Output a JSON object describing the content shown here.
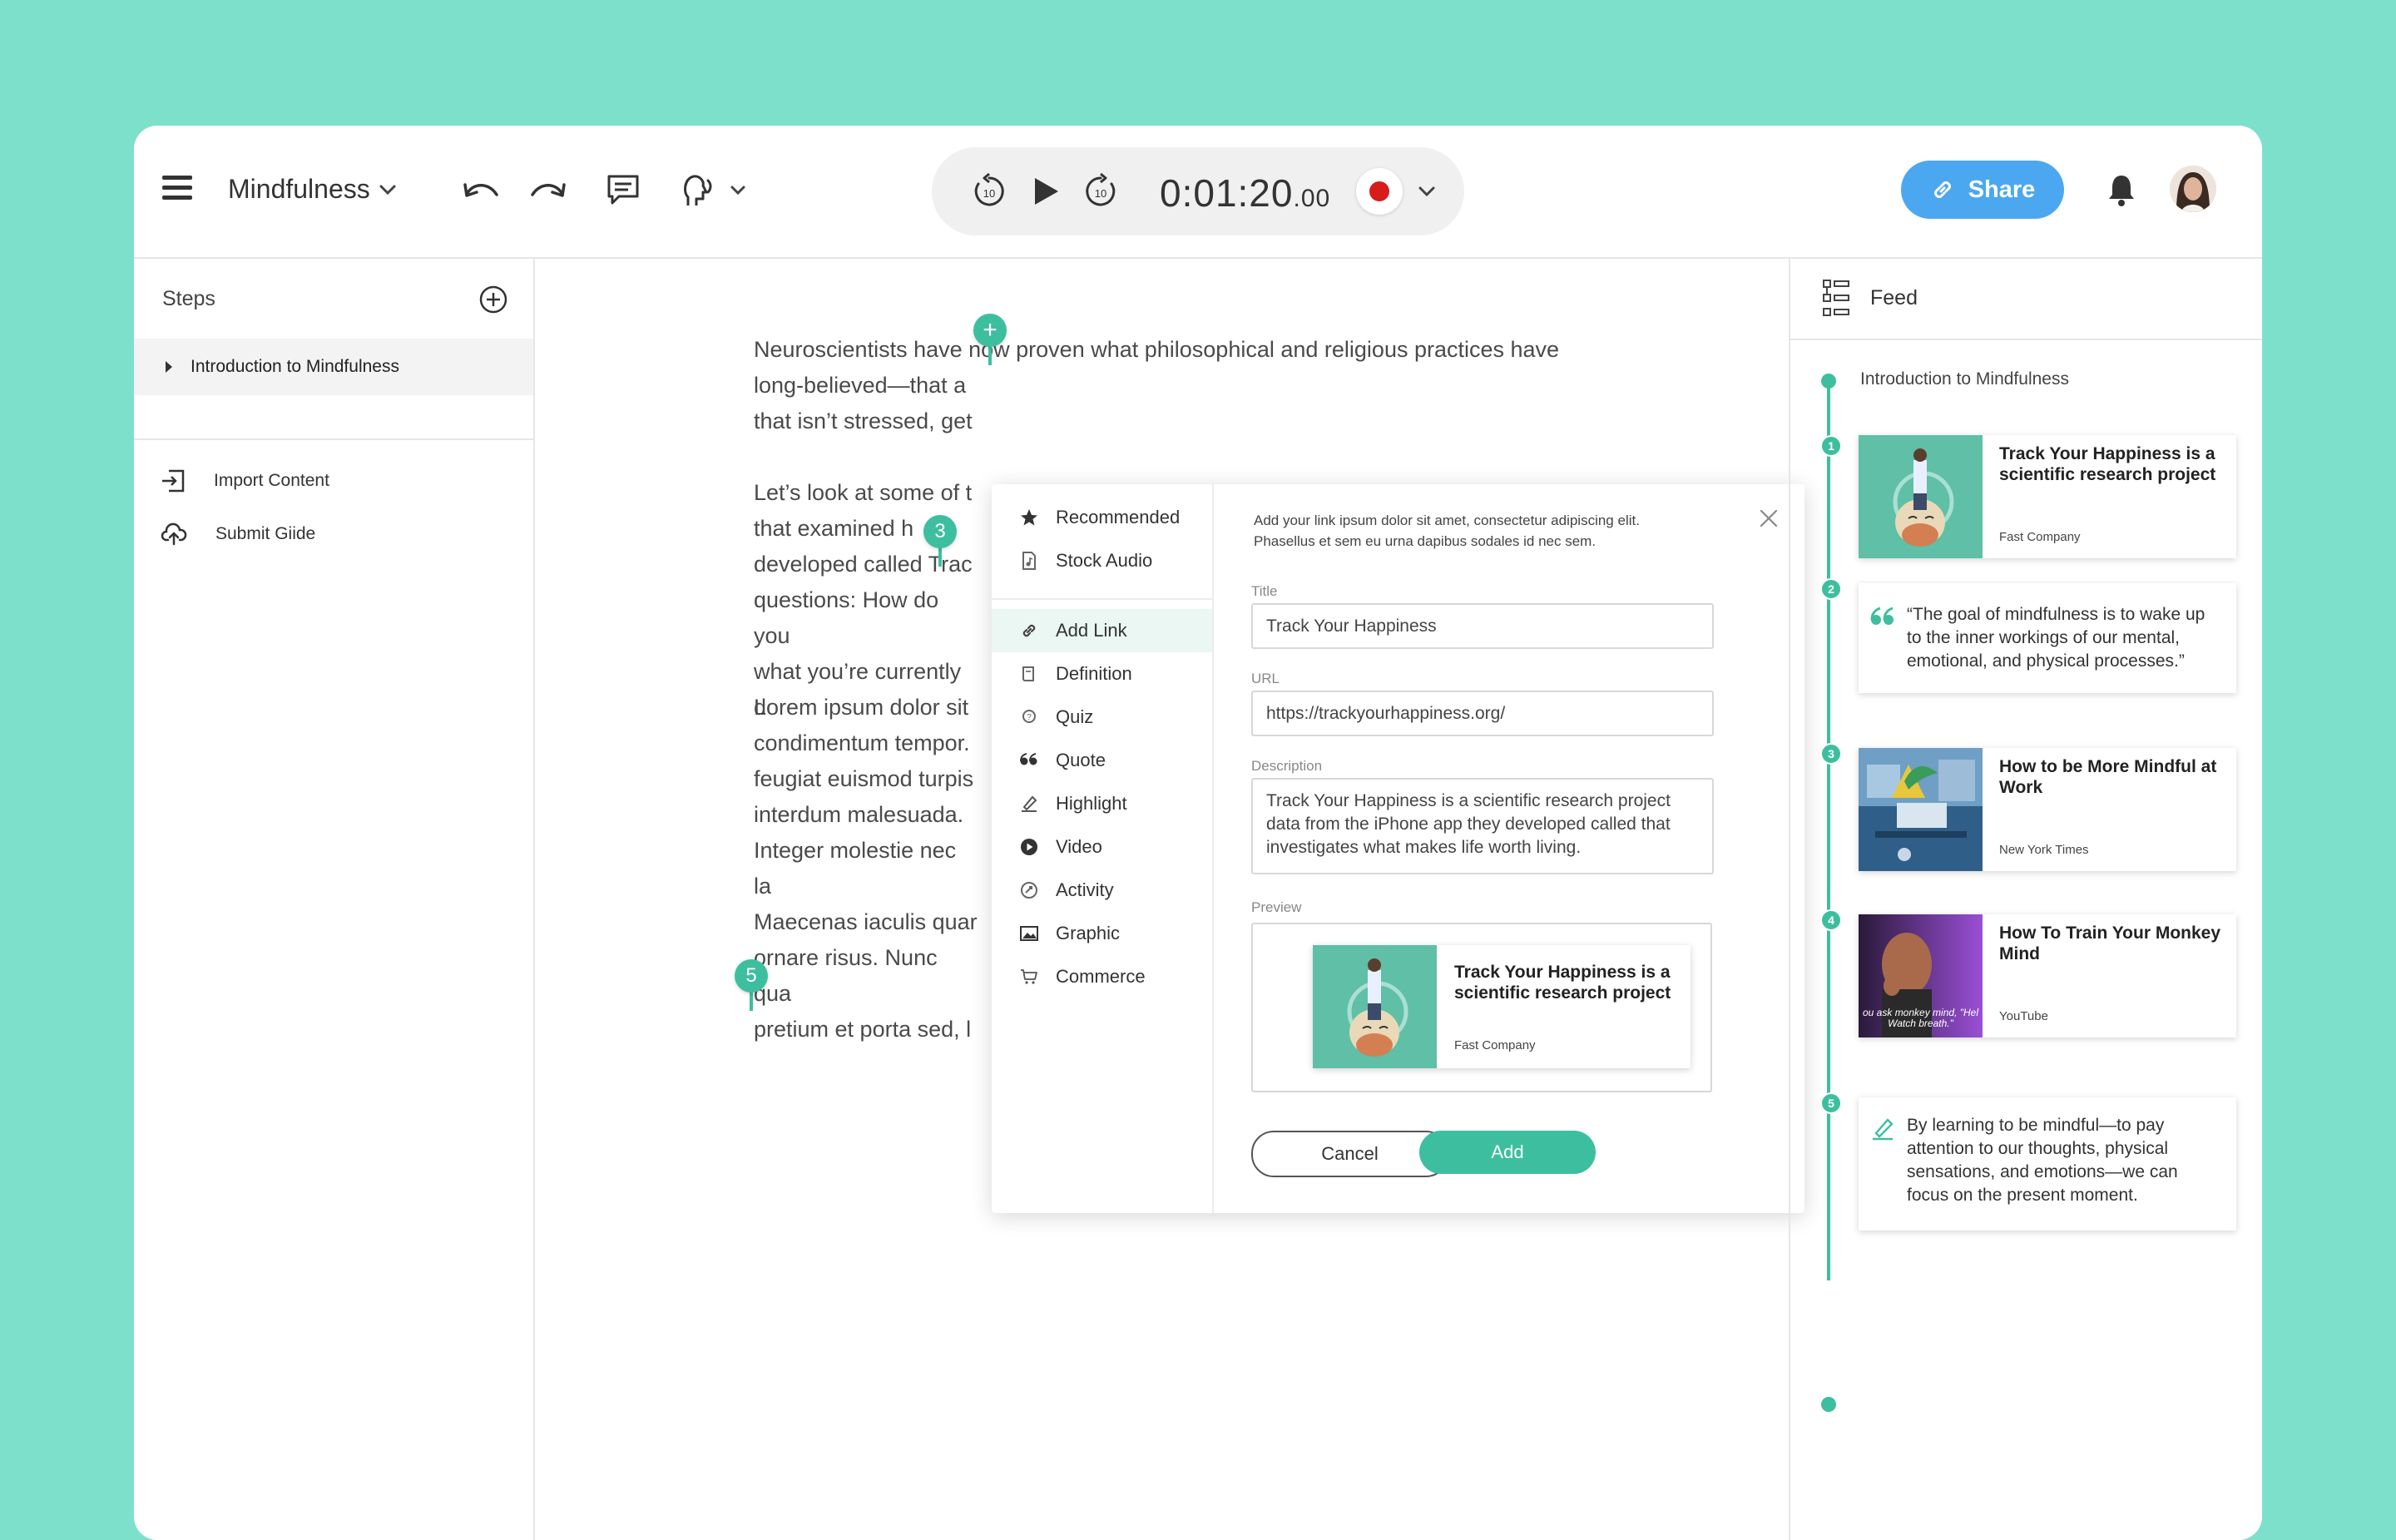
{
  "toolbar": {
    "doc_title": "Mindfulness",
    "timer_main": "0:01:20",
    "timer_ms": ".00",
    "share_label": "Share",
    "skip_back": "10",
    "skip_forward": "10"
  },
  "sidebar": {
    "steps_title": "Steps",
    "step_item": "Introduction to Mindfulness",
    "import_label": "Import Content",
    "submit_label": "Submit Giide"
  },
  "content": {
    "p1": [
      "Neuroscientists have now proven what philosophical and religious practices have",
      "long-believed—that a",
      "that isn’t stressed, get"
    ],
    "p2": [
      "Let’s look at some of t",
      "that examined h",
      "developed called Trac",
      "questions: How do you",
      "what you’re currently d"
    ],
    "p3": [
      "Lorem ipsum dolor sit",
      "condimentum tempor.",
      "feugiat euismod turpis",
      "interdum malesuada."
    ],
    "p4": [
      "Integer molestie nec la",
      "Maecenas iaculis quar",
      "ornare risus. Nunc qua",
      "pretium et porta sed, l"
    ],
    "markers": {
      "plus": "+",
      "m3": "3",
      "m5": "5"
    }
  },
  "modal": {
    "menu": [
      {
        "label": "Recommended",
        "icon": "star-icon"
      },
      {
        "label": "Stock Audio",
        "icon": "audio-file-icon"
      },
      {
        "label": "Add Link",
        "icon": "link-icon"
      },
      {
        "label": "Definition",
        "icon": "book-icon"
      },
      {
        "label": "Quiz",
        "icon": "quiz-icon"
      },
      {
        "label": "Quote",
        "icon": "quote-icon"
      },
      {
        "label": "Highlight",
        "icon": "highlighter-icon"
      },
      {
        "label": "Video",
        "icon": "play-circle-icon"
      },
      {
        "label": "Activity",
        "icon": "activity-icon"
      },
      {
        "label": "Graphic",
        "icon": "image-icon"
      },
      {
        "label": "Commerce",
        "icon": "cart-icon"
      }
    ],
    "intro_line1": "Add your link ipsum dolor sit amet, consectetur adipiscing elit.",
    "intro_line2": "Phasellus et sem eu urna dapibus sodales id nec sem.",
    "title_label": "Title",
    "title_value": "Track Your Happiness",
    "url_label": "URL",
    "url_value": "https://trackyourhappiness.org/",
    "description_label": "Description",
    "description_value": "Track Your Happiness is a scientific research project data from the iPhone app they developed called that investigates what makes life worth living.",
    "preview_label": "Preview",
    "preview_title": "Track Your Happiness is a scientific research project",
    "preview_source": "Fast Company",
    "cancel_label": "Cancel",
    "add_label": "Add"
  },
  "feed": {
    "title": "Feed",
    "intro": "Introduction to Mindfulness",
    "items": [
      {
        "num": "1",
        "title": "Track Your Happiness is a scientific research project",
        "source": "Fast Company"
      },
      {
        "num": "2",
        "quote": "“The goal of mindfulness is to wake up to the inner workings of our mental, emotional, and physical processes.”"
      },
      {
        "num": "3",
        "title": "How to be More Mindful at Work",
        "source": "New York Times"
      },
      {
        "num": "4",
        "title": "How To Train Your Monkey Mind",
        "source": "YouTube",
        "thumb_caption": "ou ask monkey mind, \"Hel Watch breath.\""
      },
      {
        "num": "5",
        "quote": "By learning to be mindful—to pay attention to our thoughts, physical sensations, and emotions—we can focus on the present moment."
      }
    ]
  },
  "colors": {
    "accent": "#3dbf9f",
    "share": "#4ba8f0",
    "record": "#d81b1b",
    "background": "#7de0cb"
  }
}
